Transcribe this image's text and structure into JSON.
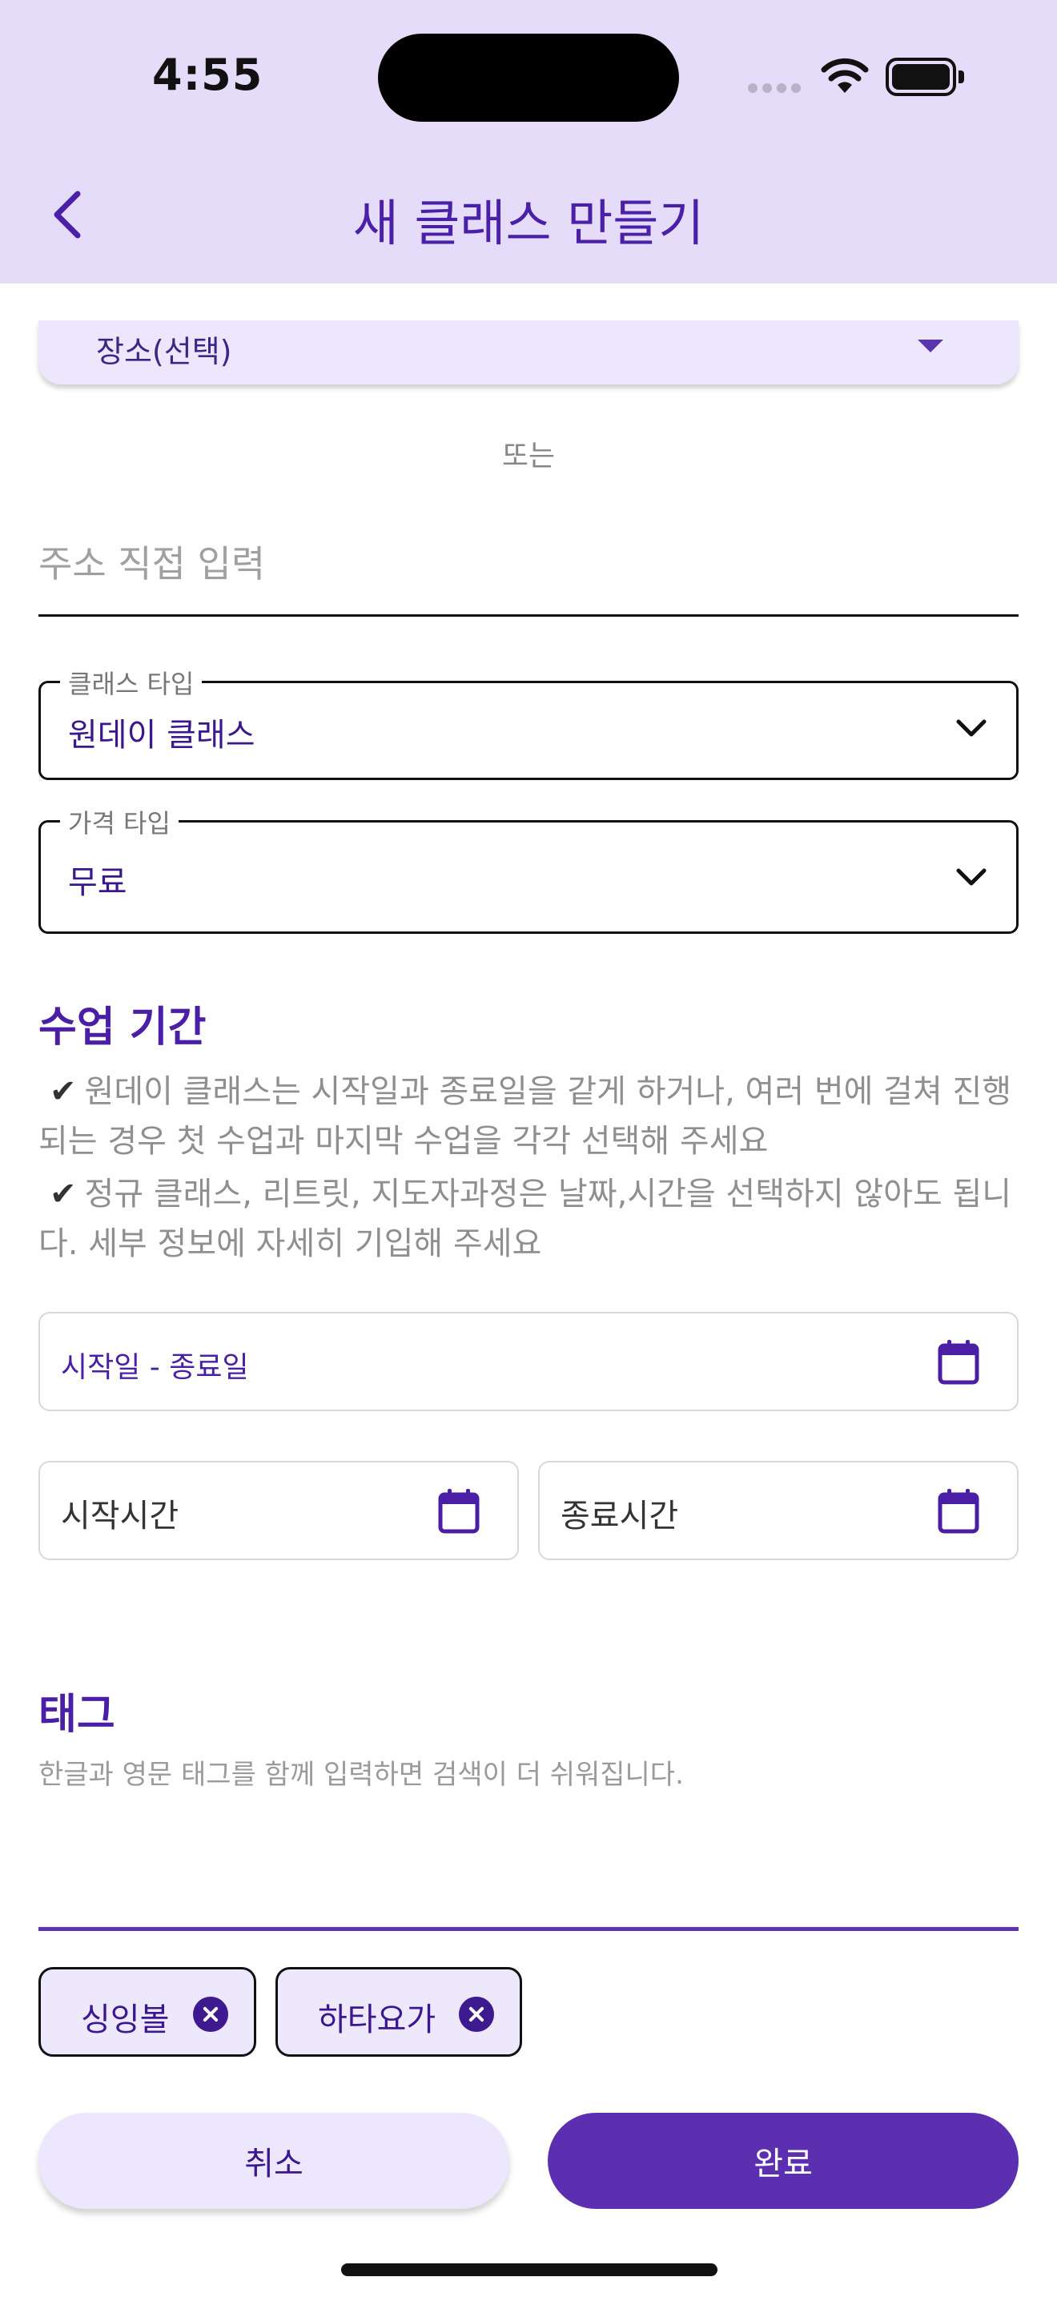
{
  "status_bar": {
    "time": "4:55"
  },
  "header": {
    "title": "새 클래스 만들기"
  },
  "location": {
    "label": "장소(선택)"
  },
  "or_label": "또는",
  "address": {
    "placeholder": "주소 직접 입력"
  },
  "class_type": {
    "label": "클래스 타입",
    "value": "원데이 클래스"
  },
  "price_type": {
    "label": "가격 타입",
    "value": "무료"
  },
  "schedule": {
    "title": "수업 기간",
    "notes": [
      "원데이 클래스는 시작일과 종료일을 같게 하거나, 여러 번에 걸쳐 진행되는 경우 첫 수업과 마지막 수업을 각각 선택해 주세요",
      "정규 클래스, 리트릿, 지도자과정은 날짜,시간을 선택하지 않아도 됩니다. 세부 정보에 자세히 기입해 주세요"
    ],
    "date_range_label": "시작일 - 종료일",
    "start_time_label": "시작시간",
    "end_time_label": "종료시간"
  },
  "tags": {
    "title": "태그",
    "helper": "한글과 영문 태그를 함께 입력하면 검색이 더 쉬워집니다.",
    "items": [
      {
        "label": "싱잉볼"
      },
      {
        "label": "하타요가"
      }
    ]
  },
  "actions": {
    "cancel": "취소",
    "done": "완료"
  },
  "colors": {
    "accent": "#5b2fb0",
    "header_bg": "#e4dcf8",
    "chip_bg": "#ede8fc"
  }
}
